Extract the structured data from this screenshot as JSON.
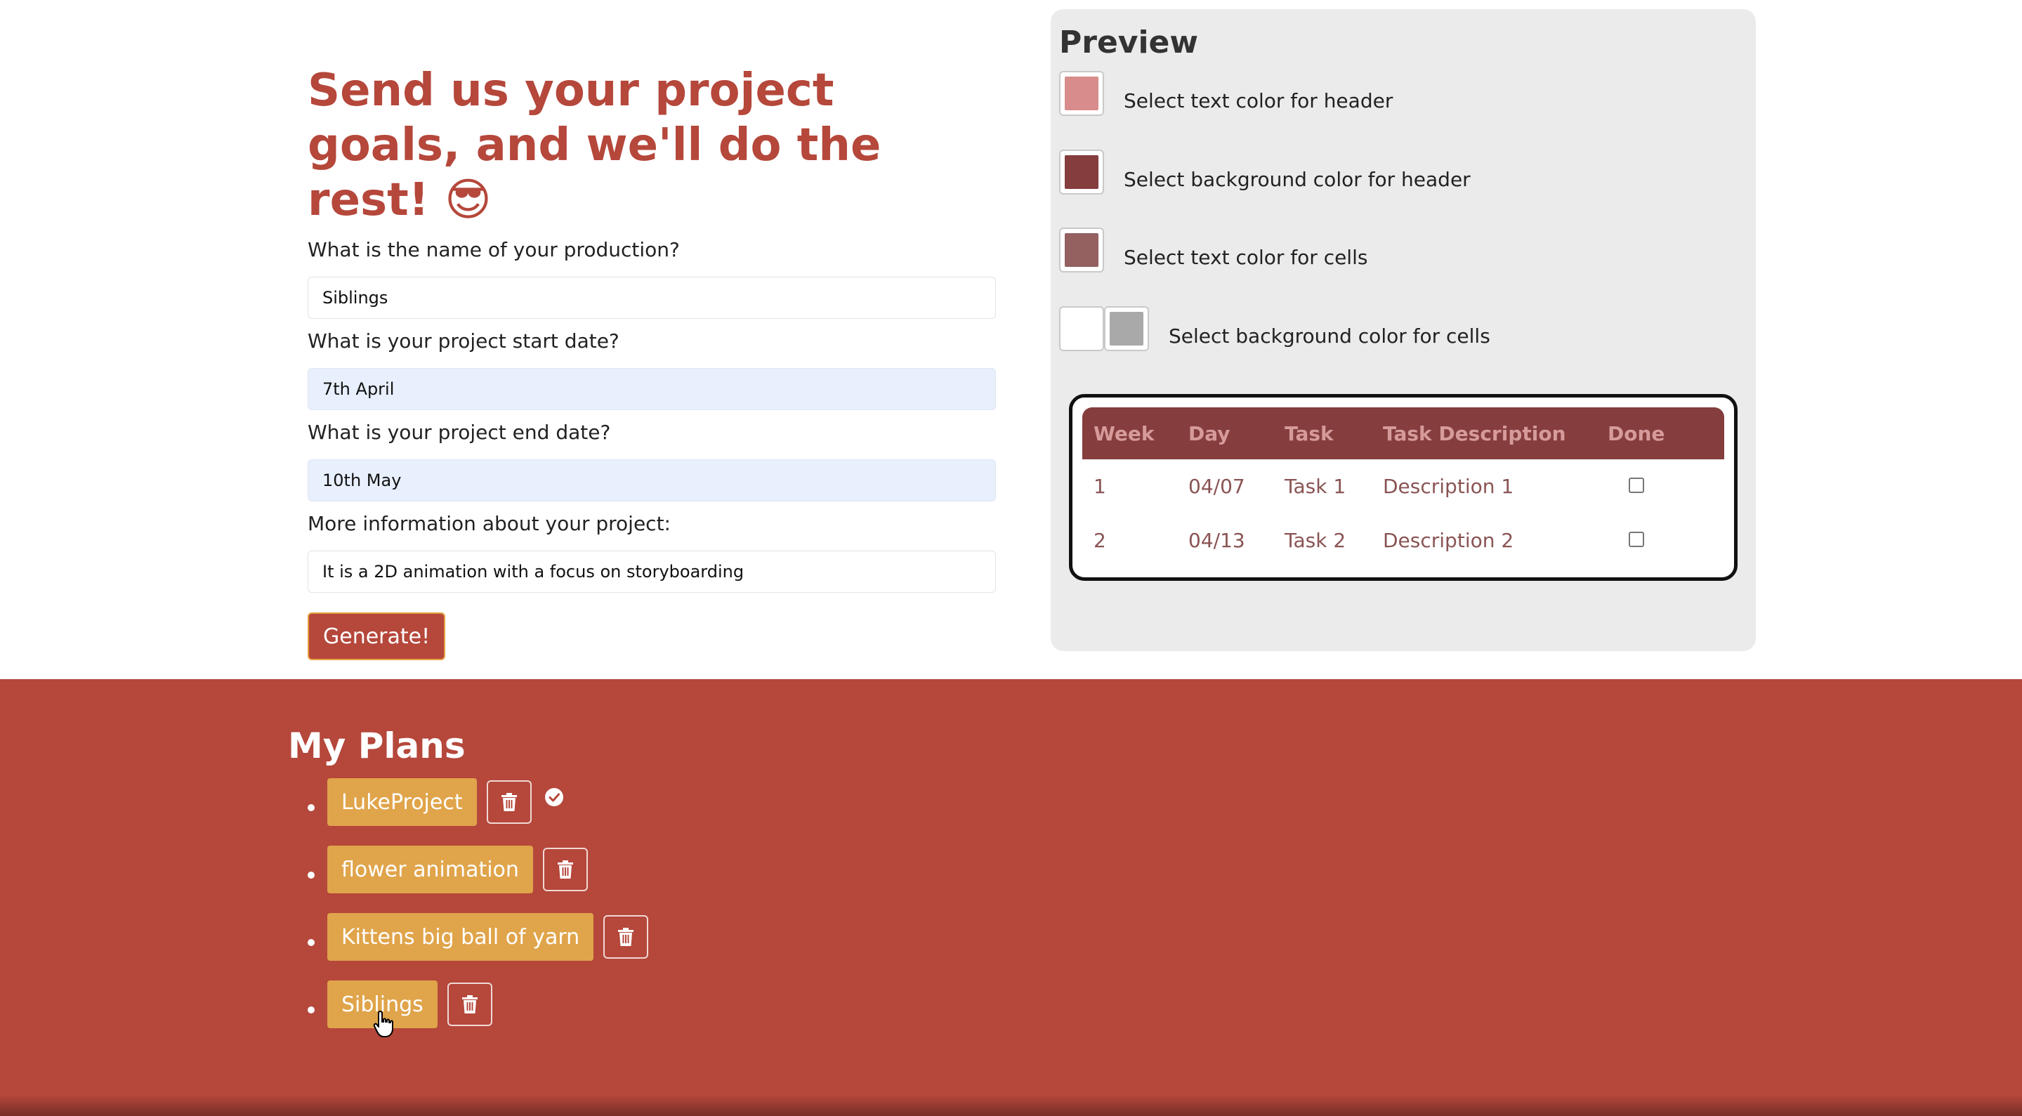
{
  "form": {
    "title": "Send us your project goals, and we'll do the rest! 😎",
    "questions": [
      {
        "label": "What is the name of your production?",
        "value": "Siblings",
        "autofill": false
      },
      {
        "label": "What is your project start date?",
        "value": "7th April",
        "autofill": true
      },
      {
        "label": "What is your project end date?",
        "value": "10th May",
        "autofill": true
      },
      {
        "label": "More information about your project:",
        "value": "It is a 2D animation with a focus on storyboarding",
        "autofill": false
      }
    ],
    "generate_label": "Generate!"
  },
  "preview": {
    "title": "Preview",
    "color_options": [
      {
        "label": "Select text color for header",
        "swatches": [
          "#d98c8c"
        ]
      },
      {
        "label": "Select background color for header",
        "swatches": [
          "#853d3d"
        ]
      },
      {
        "label": "Select text color for cells",
        "swatches": [
          "#946060"
        ]
      },
      {
        "label": "Select background color for cells",
        "swatches": [
          "#ffffff",
          "#a9a9a9"
        ]
      }
    ],
    "table": {
      "columns": [
        "Week",
        "Day",
        "Task",
        "Task Description",
        "Done"
      ],
      "rows": [
        {
          "week": "1",
          "day": "04/07",
          "task": "Task 1",
          "description": "Description 1",
          "done": false
        },
        {
          "week": "2",
          "day": "04/13",
          "task": "Task 2",
          "description": "Description 2",
          "done": false
        }
      ]
    }
  },
  "plans": {
    "title": "My Plans",
    "items": [
      {
        "name": "LukeProject",
        "selected": true
      },
      {
        "name": "flower animation",
        "selected": false
      },
      {
        "name": "Kittens big ball of yarn",
        "selected": false
      },
      {
        "name": "Siblings",
        "selected": false
      }
    ]
  },
  "colors": {
    "accent": "#b5473b",
    "plan_button": "#e0a44a",
    "header_bg": "#853d3d",
    "header_text": "#d69a9a",
    "cell_text": "#8a5454",
    "preview_bg": "#ebebeb"
  },
  "icons": {
    "trash": "trash-icon",
    "check": "check-circle-icon",
    "cursor": "hand-pointer-icon"
  }
}
